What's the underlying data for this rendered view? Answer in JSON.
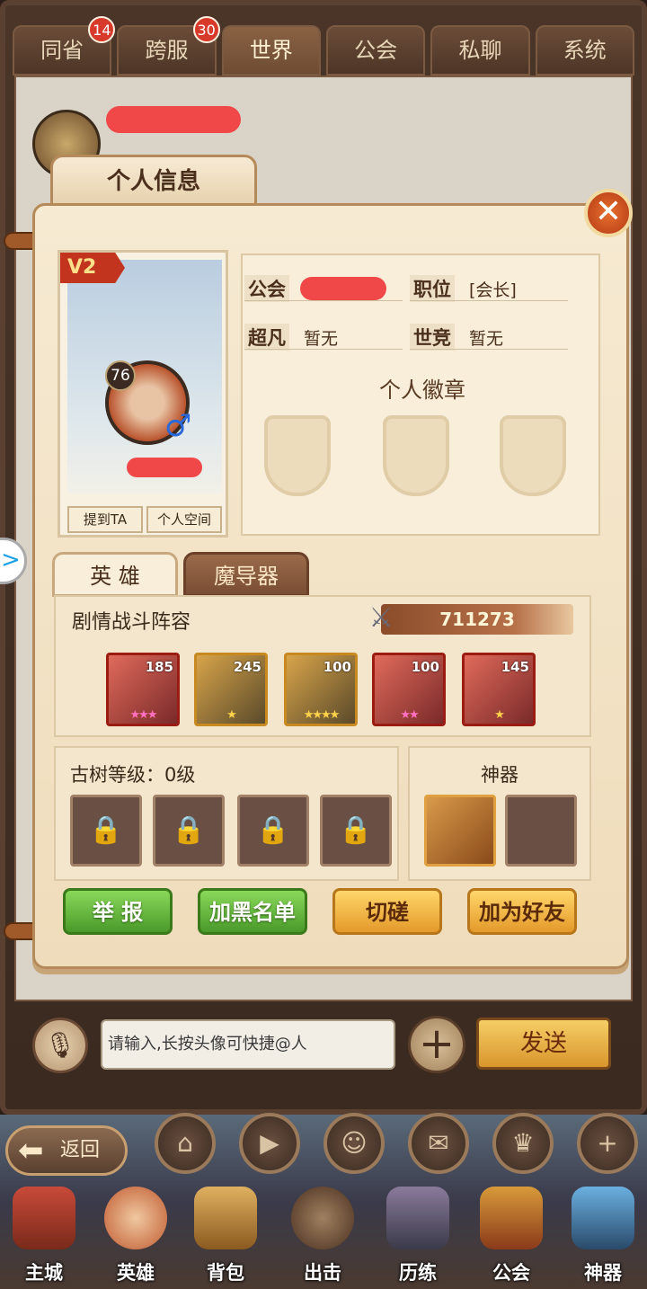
{
  "tabs": [
    {
      "label": "同省",
      "badge": "14"
    },
    {
      "label": "跨服",
      "badge": "30"
    },
    {
      "label": "世界",
      "badge": ""
    },
    {
      "label": "公会",
      "badge": ""
    },
    {
      "label": "私聊",
      "badge": ""
    },
    {
      "label": "系统",
      "badge": ""
    }
  ],
  "modal": {
    "title": "个人信息",
    "close": "✕",
    "vip": "V2",
    "hero_level": "76",
    "gender": "♂",
    "mention_btn": "提到TA",
    "space_btn": "个人空间",
    "info": {
      "guild_label": "公会",
      "position_label": "职位",
      "position_value": "[会长]",
      "chaofan_label": "超凡",
      "chaofan_value": "暂无",
      "shijing_label": "世竞",
      "shijing_value": "暂无",
      "badge_title": "个人徽章"
    },
    "subtabs": [
      "英 雄",
      "魔导器"
    ],
    "lineup_title": "剧情战斗阵容",
    "power": "711273",
    "heroes": [
      {
        "level": "185",
        "stars": "★★★",
        "star_color": "pink"
      },
      {
        "level": "245",
        "stars": "★",
        "star_color": "gold"
      },
      {
        "level": "100",
        "stars": "★★★★",
        "star_color": "gold"
      },
      {
        "level": "100",
        "stars": "★★",
        "star_color": "pink"
      },
      {
        "level": "145",
        "stars": "★",
        "star_color": "gold"
      }
    ],
    "tree_title": "古树等级：0级",
    "artifact_title": "神器",
    "buttons": {
      "report": "举 报",
      "blacklist": "加黑名单",
      "duel": "切磋",
      "add_friend": "加为好友"
    }
  },
  "chat": {
    "placeholder": "请输入,长按头像可快捷@人",
    "send": "发送"
  },
  "bottom": {
    "back": "返回",
    "nav": [
      "主城",
      "英雄",
      "背包",
      "出击",
      "历练",
      "公会",
      "神器"
    ]
  },
  "colors": {
    "accent_red": "#d73a2a",
    "green_btn": "#4a9a2a",
    "orange_btn": "#e49a2a"
  }
}
